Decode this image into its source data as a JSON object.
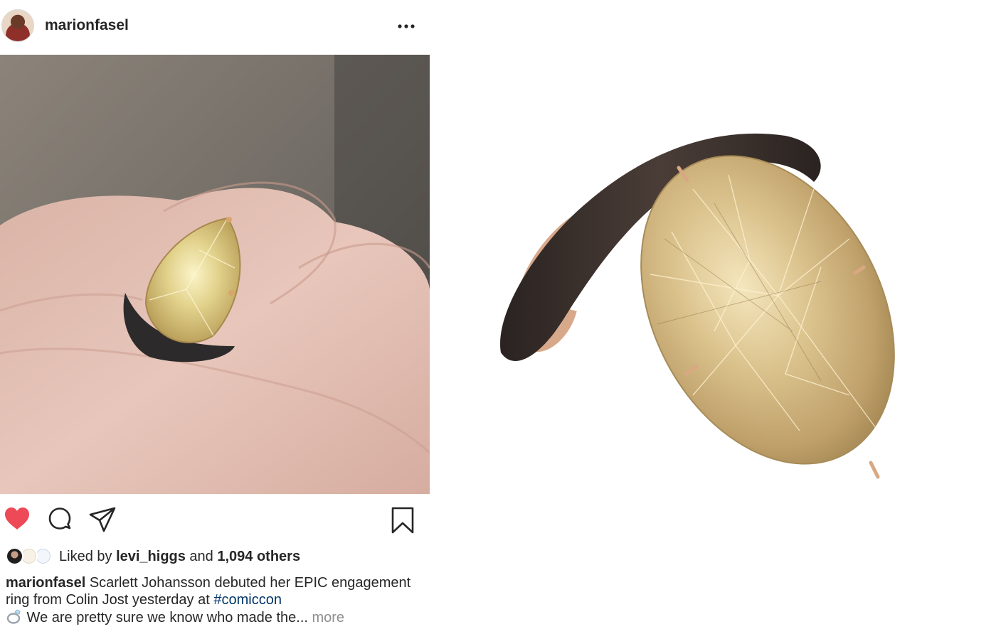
{
  "post": {
    "username": "marionfasel",
    "likes": {
      "prefix": "Liked by ",
      "liker": "levi_higgs",
      "middle": " and ",
      "count": "1,094 others"
    },
    "caption": {
      "username": "marionfasel",
      "text": " Scarlett Johansson debuted her EPIC engagement ring from Colin Jost yesterday at ",
      "hashtag": "#comiccon",
      "text2": " We are pretty sure we know who made the... ",
      "more": "more"
    },
    "icons": {
      "options": "more-horizontal-icon",
      "like": "heart-icon",
      "comment": "comment-icon",
      "share": "share-icon",
      "save": "bookmark-icon",
      "emoji": "ring-icon"
    },
    "colors": {
      "liked_heart": "#ed4956",
      "hashtag": "#003569",
      "muted": "#8e8e8e",
      "text": "#262626"
    }
  }
}
